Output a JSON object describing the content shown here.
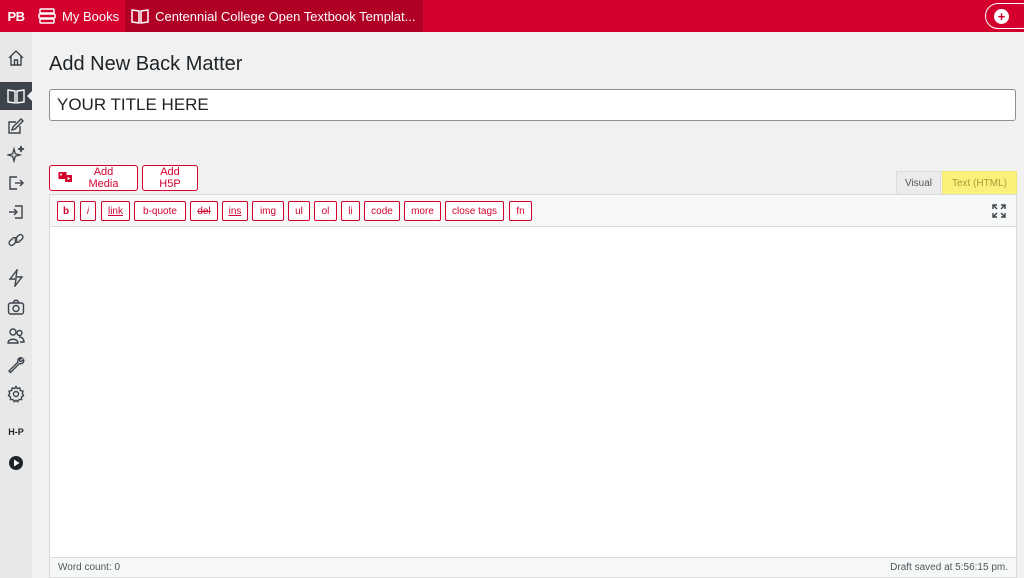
{
  "topbar": {
    "logo": "PB",
    "my_books": "My Books",
    "book_title": "Centennial College Open Textbook Templat..."
  },
  "sidemenu": {
    "h5p": "H-P"
  },
  "page": {
    "title": "Add New Back Matter",
    "title_value": "YOUR TITLE HERE"
  },
  "media_buttons": {
    "add_media": "Add Media",
    "add_h5p": "Add H5P"
  },
  "tabs": {
    "visual": "Visual",
    "text": "Text (HTML)"
  },
  "quicktags": [
    "b",
    "i",
    "link",
    "b-quote",
    "del",
    "ins",
    "img",
    "ul",
    "ol",
    "li",
    "code",
    "more",
    "close tags",
    "fn"
  ],
  "status": {
    "word_count": "Word count: 0",
    "draft_saved": "Draft saved at 5:56:15 pm."
  },
  "colors": {
    "brand": "#d4002d",
    "highlight": "#faf17a"
  }
}
